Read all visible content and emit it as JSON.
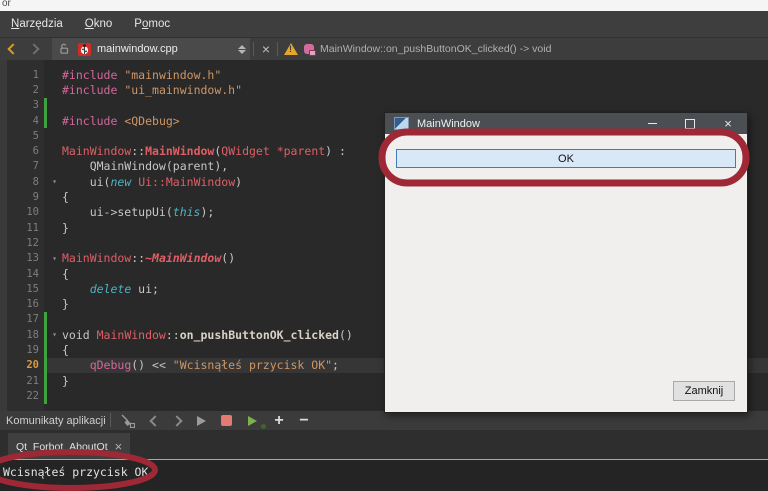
{
  "background_window": {
    "title_fragment": "or"
  },
  "menubar": {
    "items": [
      {
        "id": "tools",
        "pre": "",
        "key": "N",
        "rest": "arzędzia"
      },
      {
        "id": "window",
        "pre": "",
        "key": "O",
        "rest": "kno"
      },
      {
        "id": "help",
        "pre": "P",
        "key": "o",
        "rest": "moc"
      }
    ]
  },
  "editor_toolbar": {
    "file_tab": "mainwindow.cpp",
    "symbol": "MainWindow::on_pushButtonOK_clicked() -> void"
  },
  "editor": {
    "current_line": 20,
    "changed_ranges": [
      [
        3,
        4
      ],
      [
        17,
        22
      ]
    ],
    "fold_lines": [
      8,
      13,
      18
    ],
    "lines": [
      [
        [
          "pp",
          "#include"
        ],
        [
          "pl",
          " "
        ],
        [
          "str",
          "\"mainwindow.h\""
        ]
      ],
      [
        [
          "pp",
          "#include"
        ],
        [
          "pl",
          " "
        ],
        [
          "str",
          "\"ui_mainwindow.h\""
        ]
      ],
      [],
      [
        [
          "pp",
          "#include"
        ],
        [
          "pl",
          " "
        ],
        [
          "str",
          "<QDebug>"
        ]
      ],
      [],
      [
        [
          "ty",
          "MainWindow"
        ],
        [
          "pl",
          "::"
        ],
        [
          "tyb",
          "MainWindow"
        ],
        [
          "pl",
          "("
        ],
        [
          "ty",
          "QWidget"
        ],
        [
          "pl",
          " "
        ],
        [
          "ty",
          "*parent"
        ],
        [
          "pl",
          ") :"
        ]
      ],
      [
        [
          "pl",
          "    QMainWindow(parent),"
        ]
      ],
      [
        [
          "pl",
          "    ui("
        ],
        [
          "kw",
          "new"
        ],
        [
          "pl",
          " "
        ],
        [
          "ty",
          "Ui::MainWindow"
        ],
        [
          "pl",
          ")"
        ]
      ],
      [
        [
          "pl",
          "{"
        ]
      ],
      [
        [
          "pl",
          "    ui->setupUi("
        ],
        [
          "kw",
          "this"
        ],
        [
          "pl",
          ");"
        ]
      ],
      [
        [
          "pl",
          "}"
        ]
      ],
      [],
      [
        [
          "ty",
          "MainWindow"
        ],
        [
          "pl",
          "::"
        ],
        [
          "tybi",
          "~MainWindow"
        ],
        [
          "pl",
          "()"
        ]
      ],
      [
        [
          "pl",
          "{"
        ]
      ],
      [
        [
          "pl",
          "    "
        ],
        [
          "kw",
          "delete"
        ],
        [
          "pl",
          " ui;"
        ]
      ],
      [
        [
          "pl",
          "}"
        ]
      ],
      [],
      [
        [
          "pl",
          "void "
        ],
        [
          "ty",
          "MainWindow"
        ],
        [
          "pl",
          "::"
        ],
        [
          "fn",
          "on_pushButtonOK_clicked"
        ],
        [
          "pl",
          "()"
        ]
      ],
      [
        [
          "pl",
          "{"
        ]
      ],
      [
        [
          "pl",
          "    "
        ],
        [
          "pp",
          "qDebug"
        ],
        [
          "pl",
          "() << "
        ],
        [
          "str",
          "\"Wcisnąłeś przycisk OK\""
        ],
        [
          "pl",
          ";"
        ]
      ],
      [
        [
          "pl",
          "}"
        ]
      ],
      []
    ]
  },
  "dialog": {
    "title": "MainWindow",
    "ok_button": "OK",
    "close_button": "Zamknij"
  },
  "bottom_panel": {
    "label": "Komunikaty aplikacji",
    "tab": "Qt_Forbot_AboutQt",
    "output": "Wcisnąłeś przycisk OK"
  },
  "icons": {
    "close_glyph": "×",
    "plus_glyph": "+",
    "minus_glyph": "−",
    "fold_glyph": "▾"
  },
  "colors": {
    "annotation": "#9e2836",
    "changed_line_marker": "#3fa23f",
    "current_line_number": "#d79b3f",
    "back_arrow": "#d5a021",
    "warning": "#e3a82b",
    "stop_icon": "#e27b72",
    "run_icon_green": "#7db14c",
    "ok_button_bg": "#d9e8f7",
    "ok_button_border": "#3f7cb8",
    "dialog_body": "#f0efed",
    "dialog_titlebar": "#4b4f53",
    "editor_bg": "#292929"
  }
}
